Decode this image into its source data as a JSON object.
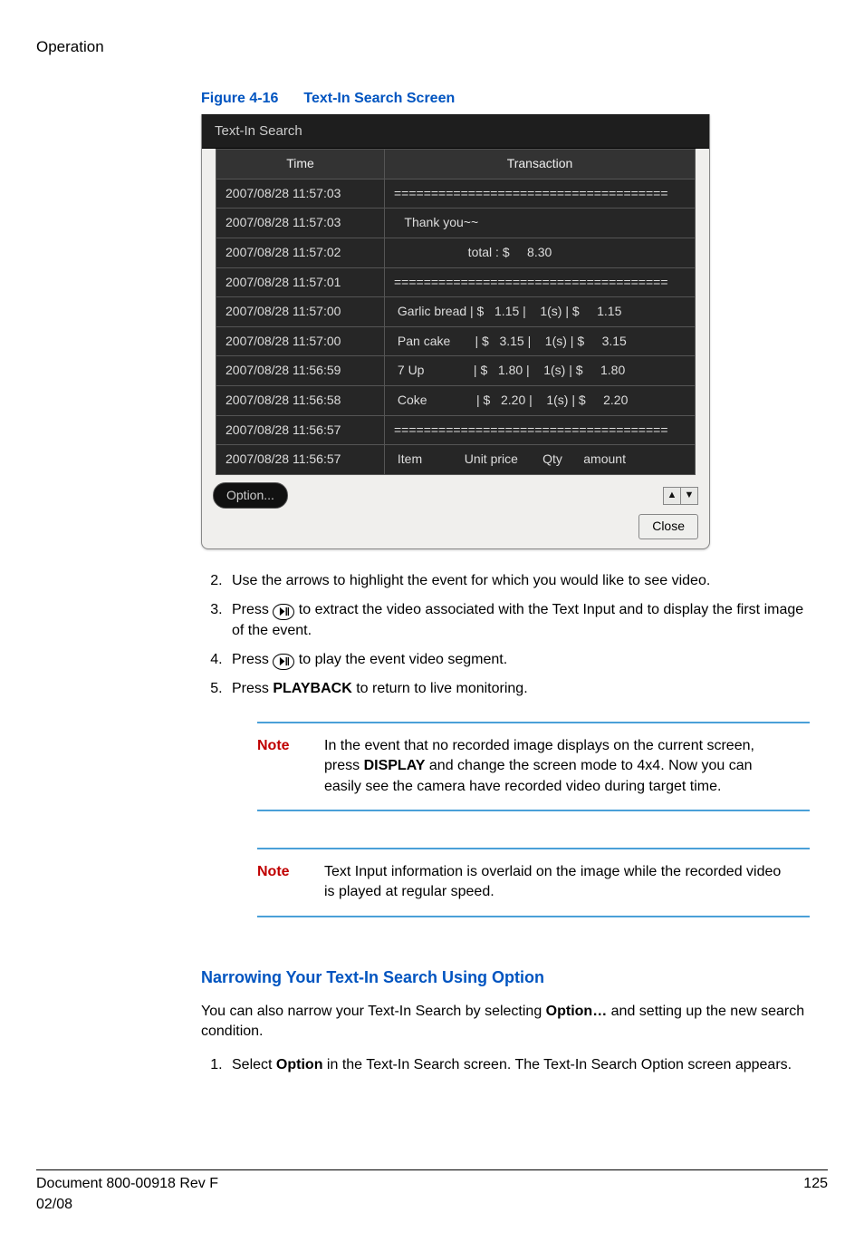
{
  "section_label": "Operation",
  "figure": {
    "num": "Figure 4-16",
    "title": "Text-In Search Screen"
  },
  "screenshot": {
    "window_title": "Text-In Search",
    "headers": {
      "time": "Time",
      "transaction": "Transaction"
    },
    "rows": [
      {
        "time": "2007/08/28  11:57:03",
        "tx": "====================================="
      },
      {
        "time": "2007/08/28  11:57:03",
        "tx": "   Thank you~~"
      },
      {
        "time": "2007/08/28  11:57:02",
        "tx": "                     total : $     8.30"
      },
      {
        "time": "2007/08/28  11:57:01",
        "tx": "====================================="
      },
      {
        "time": "2007/08/28  11:57:00",
        "tx": " Garlic bread | $   1.15 |    1(s) | $     1.15"
      },
      {
        "time": "2007/08/28  11:57:00",
        "tx": " Pan cake       | $   3.15 |    1(s) | $     3.15"
      },
      {
        "time": "2007/08/28  11:56:59",
        "tx": " 7 Up              | $   1.80 |    1(s) | $     1.80"
      },
      {
        "time": "2007/08/28  11:56:58",
        "tx": " Coke              | $   2.20 |    1(s) | $     2.20"
      },
      {
        "time": "2007/08/28  11:56:57",
        "tx": "====================================="
      },
      {
        "time": "2007/08/28  11:56:57",
        "tx": " Item            Unit price       Qty      amount"
      }
    ],
    "option_label": "Option...",
    "close_label": "Close",
    "up_glyph": "▲",
    "down_glyph": "▼"
  },
  "steps": {
    "s2": "Use the arrows to highlight the event for which you would like to see video.",
    "s3a": "Press ",
    "s3b": " to extract the video associated with the Text Input and to display the first image of the event.",
    "s4a": "Press ",
    "s4b": " to play the event video segment.",
    "s5a": "Press ",
    "s5b_bold": "PLAYBACK",
    "s5c": " to return to live monitoring."
  },
  "note1": {
    "label": "Note",
    "text_a": "In the event that no recorded image displays on the current screen, press ",
    "text_b_bold": "DISPLAY",
    "text_c": " and change the screen mode to 4x4. Now you can easily see the camera have recorded video during target time."
  },
  "note2": {
    "label": "Note",
    "text": "Text Input information is overlaid on the image while the recorded video is played at regular speed."
  },
  "narrow": {
    "heading": "Narrowing Your Text-In Search Using Option",
    "para_a": "You can also narrow your Text-In Search by selecting ",
    "para_b_bold": "Option…",
    "para_c": " and setting up the new search condition.",
    "step1_a": "Select ",
    "step1_b_bold": "Option",
    "step1_c": " in the Text-In Search screen. The Text-In Search Option screen appears."
  },
  "footer": {
    "left1": "Document 800-00918 Rev F",
    "left2": "02/08",
    "right": "125"
  }
}
